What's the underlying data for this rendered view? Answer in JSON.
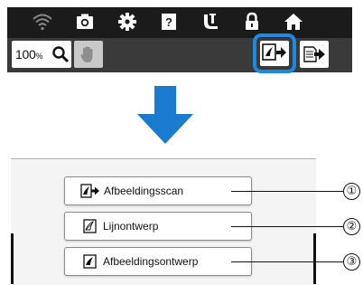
{
  "toolbar": {
    "status_icons": [
      {
        "name": "wifi-icon"
      },
      {
        "name": "camera-icon"
      },
      {
        "name": "settings-icon"
      },
      {
        "name": "help-icon"
      },
      {
        "name": "bobbin-icon"
      },
      {
        "name": "lock-icon"
      },
      {
        "name": "home-icon"
      }
    ],
    "zoom_value": "100",
    "zoom_unit": "%",
    "icons": {
      "zoom": "magnifier-icon",
      "hand": "hand-pan-icon",
      "scan": "image-scan-icon",
      "export": "export-icon"
    },
    "highlight_color": "#1a8be0"
  },
  "arrow": {
    "color": "#1a7bd0",
    "icon": "arrow-down-icon"
  },
  "menu": {
    "items": [
      {
        "label": "Afbeeldingsscan",
        "icon": "scan-image-icon",
        "callout": "①"
      },
      {
        "label": "Lijnontwerp",
        "icon": "line-design-icon",
        "callout": "②"
      },
      {
        "label": "Afbeeldingsontwerp",
        "icon": "illustration-design-icon",
        "callout": "③"
      }
    ]
  }
}
